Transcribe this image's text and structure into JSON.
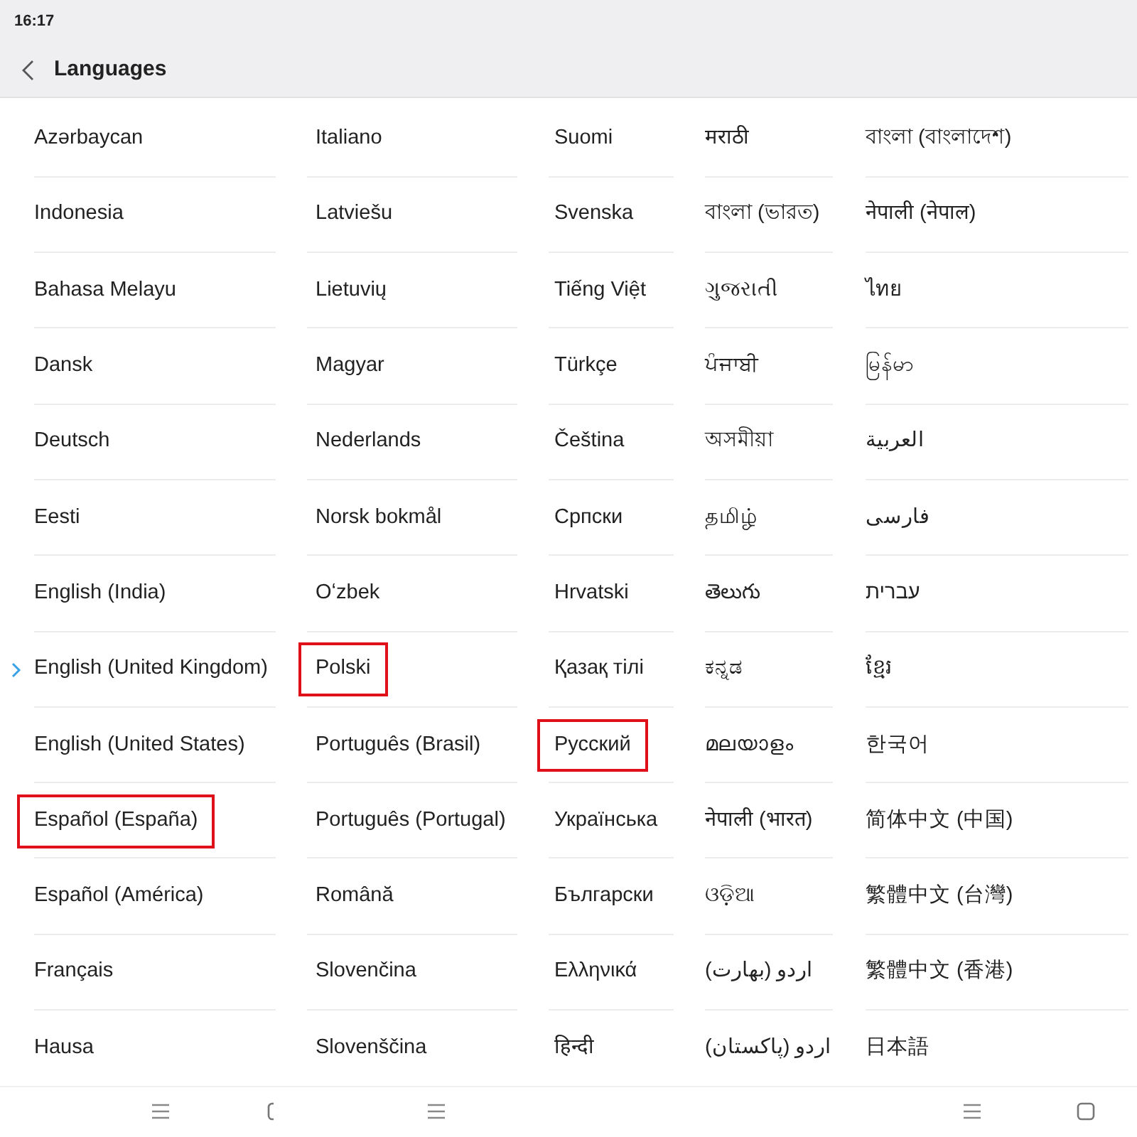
{
  "status_bar": {
    "time": "16:17"
  },
  "header": {
    "title": "Languages"
  },
  "columns": [
    {
      "items": [
        {
          "label": "Azərbaycan",
          "selected": false,
          "highlighted": false
        },
        {
          "label": "Indonesia",
          "selected": false,
          "highlighted": false
        },
        {
          "label": "Bahasa Melayu",
          "selected": false,
          "highlighted": false
        },
        {
          "label": "Dansk",
          "selected": false,
          "highlighted": false
        },
        {
          "label": "Deutsch",
          "selected": false,
          "highlighted": false
        },
        {
          "label": "Eesti",
          "selected": false,
          "highlighted": false
        },
        {
          "label": "English (India)",
          "selected": false,
          "highlighted": false
        },
        {
          "label": "English (United Kingdom)",
          "selected": true,
          "highlighted": false
        },
        {
          "label": "English (United States)",
          "selected": false,
          "highlighted": false
        },
        {
          "label": "Español (España)",
          "selected": false,
          "highlighted": true
        },
        {
          "label": "Español (América)",
          "selected": false,
          "highlighted": false
        },
        {
          "label": "Français",
          "selected": false,
          "highlighted": false
        },
        {
          "label": "Hausa",
          "selected": false,
          "highlighted": false
        }
      ]
    },
    {
      "items": [
        {
          "label": "Italiano",
          "selected": false,
          "highlighted": false
        },
        {
          "label": "Latviešu",
          "selected": false,
          "highlighted": false
        },
        {
          "label": "Lietuvių",
          "selected": false,
          "highlighted": false
        },
        {
          "label": "Magyar",
          "selected": false,
          "highlighted": false
        },
        {
          "label": "Nederlands",
          "selected": false,
          "highlighted": false
        },
        {
          "label": "Norsk bokmål",
          "selected": false,
          "highlighted": false
        },
        {
          "label": "Oʻzbek",
          "selected": false,
          "highlighted": false
        },
        {
          "label": "Polski",
          "selected": false,
          "highlighted": true
        },
        {
          "label": "Português (Brasil)",
          "selected": false,
          "highlighted": false
        },
        {
          "label": "Português (Portugal)",
          "selected": false,
          "highlighted": false
        },
        {
          "label": "Română",
          "selected": false,
          "highlighted": false
        },
        {
          "label": "Slovenčina",
          "selected": false,
          "highlighted": false
        },
        {
          "label": "Slovenščina",
          "selected": false,
          "highlighted": false
        }
      ]
    },
    {
      "items": [
        {
          "label": "Suomi",
          "selected": false,
          "highlighted": false
        },
        {
          "label": "Svenska",
          "selected": false,
          "highlighted": false
        },
        {
          "label": "Tiếng Việt",
          "selected": false,
          "highlighted": false
        },
        {
          "label": "Türkçe",
          "selected": false,
          "highlighted": false
        },
        {
          "label": "Čeština",
          "selected": false,
          "highlighted": false
        },
        {
          "label": "Српски",
          "selected": false,
          "highlighted": false
        },
        {
          "label": "Hrvatski",
          "selected": false,
          "highlighted": false
        },
        {
          "label": "Қазақ тілі",
          "selected": false,
          "highlighted": false
        },
        {
          "label": "Русский",
          "selected": false,
          "highlighted": true
        },
        {
          "label": "Українська",
          "selected": false,
          "highlighted": false
        },
        {
          "label": "Български",
          "selected": false,
          "highlighted": false
        },
        {
          "label": "Ελληνικά",
          "selected": false,
          "highlighted": false
        },
        {
          "label": "हिन्दी",
          "selected": false,
          "highlighted": false
        }
      ]
    },
    {
      "items": [
        {
          "label": "मराठी",
          "selected": false,
          "highlighted": false
        },
        {
          "label": "বাংলা (ভারত)",
          "selected": false,
          "highlighted": false
        },
        {
          "label": "ગુજરાતી",
          "selected": false,
          "highlighted": false
        },
        {
          "label": "ਪੰਜਾਬੀ",
          "selected": false,
          "highlighted": false
        },
        {
          "label": "অসমীয়া",
          "selected": false,
          "highlighted": false
        },
        {
          "label": "தமிழ்",
          "selected": false,
          "highlighted": false
        },
        {
          "label": "తెలుగు",
          "selected": false,
          "highlighted": false
        },
        {
          "label": "ಕನ್ನಡ",
          "selected": false,
          "highlighted": false
        },
        {
          "label": "മലയാളം",
          "selected": false,
          "highlighted": false
        },
        {
          "label": "नेपाली (भारत)",
          "selected": false,
          "highlighted": false
        },
        {
          "label": "ଓଡ଼ିଆ",
          "selected": false,
          "highlighted": false
        },
        {
          "label": "اردو (بھارت)",
          "selected": false,
          "highlighted": false
        },
        {
          "label": "اردو (پاکستان)",
          "selected": false,
          "highlighted": false
        }
      ]
    },
    {
      "items": [
        {
          "label": "বাংলা (বাংলাদেশ)",
          "selected": false,
          "highlighted": false
        },
        {
          "label": "नेपाली (नेपाल)",
          "selected": false,
          "highlighted": false
        },
        {
          "label": "ไทย",
          "selected": false,
          "highlighted": false
        },
        {
          "label": "မြန်မာ",
          "selected": false,
          "highlighted": false
        },
        {
          "label": "العربية",
          "selected": false,
          "highlighted": false
        },
        {
          "label": "فارسی",
          "selected": false,
          "highlighted": false
        },
        {
          "label": "עברית",
          "selected": false,
          "highlighted": false
        },
        {
          "label": "ខ្មែរ",
          "selected": false,
          "highlighted": false
        },
        {
          "label": "한국어",
          "selected": false,
          "highlighted": false
        },
        {
          "label": "简体中文 (中国)",
          "selected": false,
          "highlighted": false
        },
        {
          "label": "繁體中文 (台灣)",
          "selected": false,
          "highlighted": false
        },
        {
          "label": "繁體中文 (香港)",
          "selected": false,
          "highlighted": false
        },
        {
          "label": "日本語",
          "selected": false,
          "highlighted": false
        }
      ]
    }
  ]
}
